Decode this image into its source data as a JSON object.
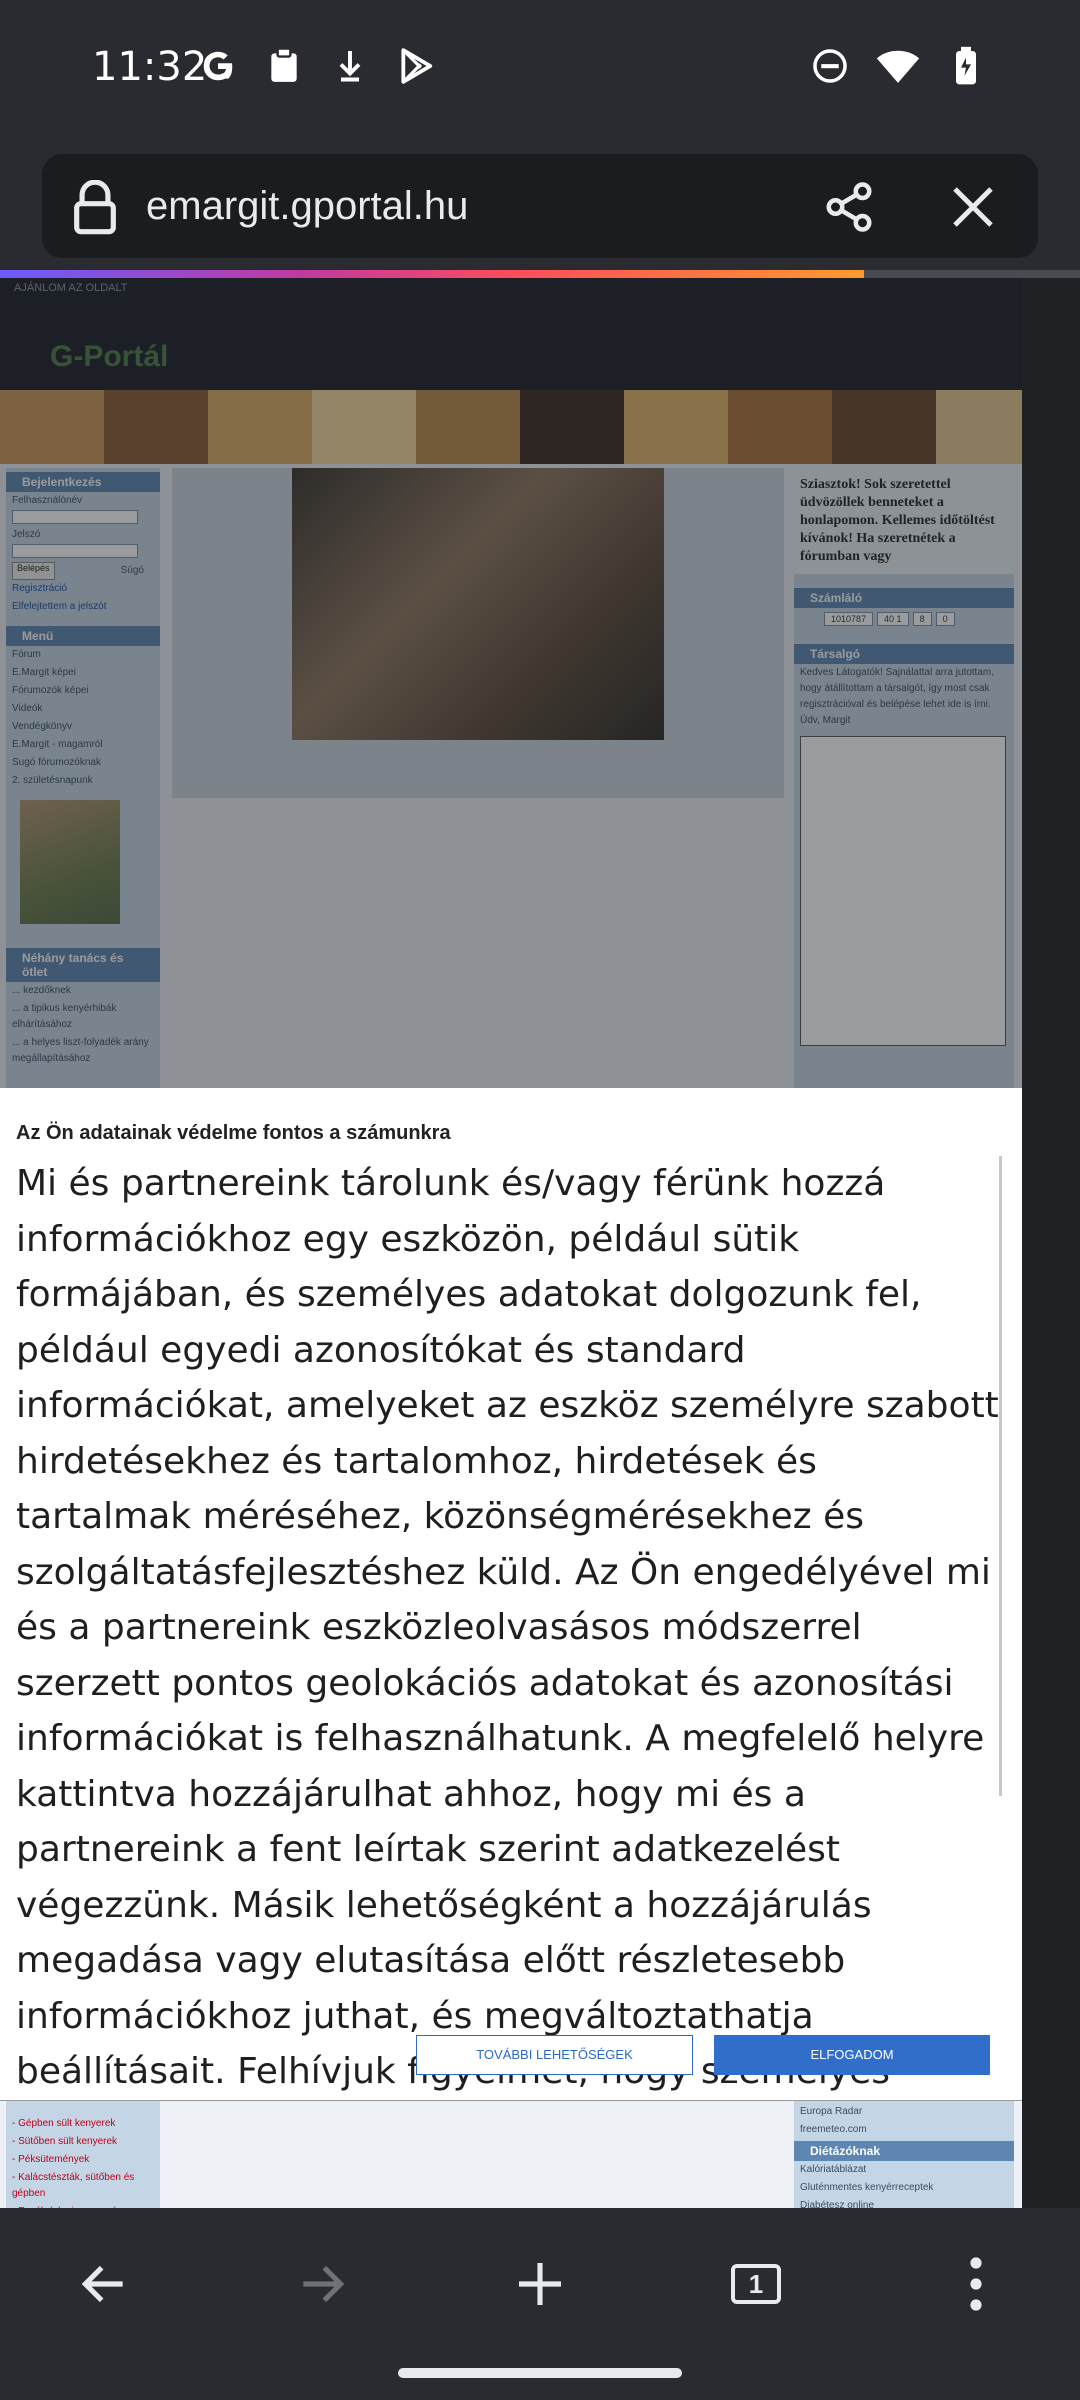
{
  "status": {
    "time": "11:32",
    "left_icons": [
      "google-icon",
      "clipboard-icon",
      "download-arrow-icon",
      "play-store-icon"
    ],
    "right_icons": [
      "dnd-icon",
      "wifi-icon",
      "battery-icon"
    ]
  },
  "browser": {
    "url": "emargit.gportal.hu",
    "tab_count": "1",
    "progress": 0.8
  },
  "site": {
    "recommend": "AJÁNLOM AZ OLDALT",
    "logo": "G-Portál",
    "login_title": "Bejelentkezés",
    "username_label": "Felhasználónév",
    "password_label": "Jelszó",
    "login_button": "Belépés",
    "help": "Súgó",
    "register": "Regisztráció",
    "forgot": "Elfelejtettem a jelszót",
    "menu_title": "Menü",
    "menu_items": [
      "Fórum",
      "E.Margit képei",
      "Fórumozók képei",
      "Videók",
      "Vendégkönyv",
      "E.Margit - magamról",
      "Sugó fórumozóknak",
      "2. születésnapunk"
    ],
    "tips_title": "Néhány tanács és ötlet",
    "tips_items": [
      "... kezdőknek",
      "... a tipikus kenyérhibák elhárításához",
      "... a helyes liszt-folyadék arány megállapításához"
    ],
    "welcome": "Sziasztok! Sok szeretettel üdvözöllek benneteket a honlapomon. Kellemes időtöltést kívánok! Ha szeretnétek a fórumban vagy",
    "counter_title": "Számláló",
    "counter_values": [
      "1010787",
      "40 1",
      "8",
      "0"
    ],
    "chat_title": "Társalgó",
    "chat_text": "Kedves Látogatók! Sajnálattal arra jutottam, hogy átállítottam a társalgót, így most csak regisztrációval és belépése lehet ide is írni. Üdv, Margit",
    "bottom_left": [
      "- Gépben sült kenyerek",
      "- Sütőben sült kenyerek",
      "- Péksütemények",
      "- Kalácstészták, sütőben és gépben",
      "- Egyéb (pl. pizza, pogácsa,"
    ],
    "bottom_right_top": [
      "Europa Radar",
      "freemeteo.com"
    ],
    "diet_title": "Diétázóknak",
    "bottom_right": [
      "Kalóriatáblázat",
      "Gluténmentes kenyérreceptek",
      "Diabétesz online"
    ]
  },
  "consent": {
    "title": "Az Ön adatainak védelme fontos a számunkra",
    "body": "Mi és partnereink tárolunk és/vagy férünk hozzá információkhoz egy eszközön, például sütik formájában, és személyes adatokat dolgozunk fel, például egyedi azonosítókat és standard információkat, amelyeket az eszköz személyre szabott hirdetésekhez és tartalomhoz, hirdetések és tartalmak méréséhez, közönségmérésekhez és szolgáltatásfejlesztéshez küld. Az Ön engedélyével mi és a partnereink eszközleolvasásos módszerrel szerzett pontos geolokációs adatokat és azonosítási információkat is felhasználhatunk. A megfelelő helyre kattintva hozzájárulhat ahhoz, hogy mi és a partnereink a fent leírtak szerint adatkezelést végezzünk. Másik lehetőségként a hozzájárulás megadása vagy elutasítása előtt részletesebb információkhoz juthat, és megváltoztathatja beállításait. Felhívjuk figyelmét, hogy személyes adatainak bizonyos kezeléséhez nem feltétlenül szükséges az Ön hozzájárulása,",
    "more_button": "TOVÁBBI LEHETŐSÉGEK",
    "accept_button": "ELFOGADOM"
  },
  "colors": {
    "system_bar": "#2a2b30",
    "accent": "#2f6fcb"
  }
}
